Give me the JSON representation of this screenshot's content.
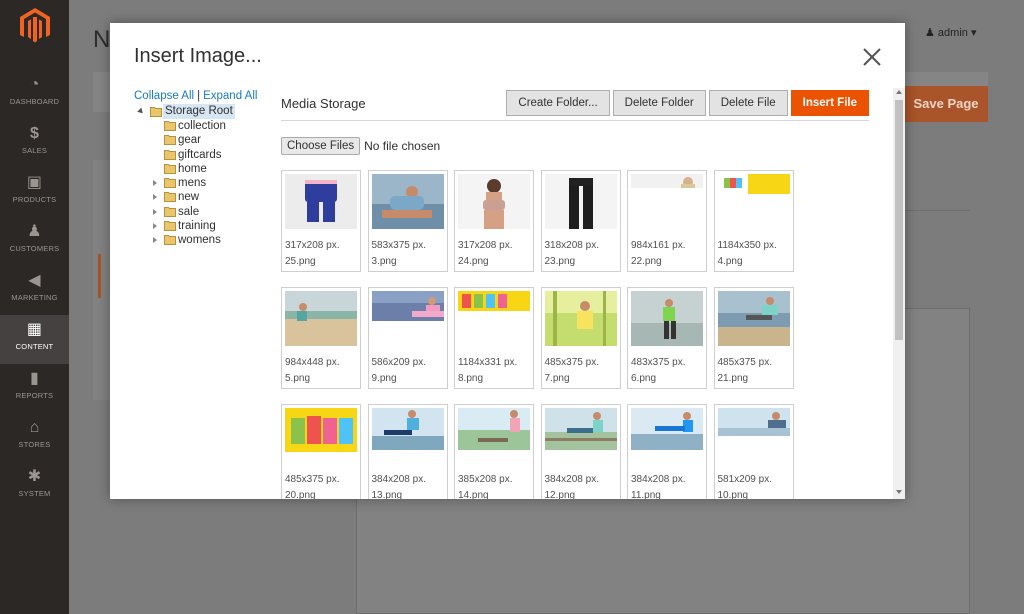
{
  "admin_nav": [
    {
      "label": "DASHBOARD",
      "icon": "dashboard-icon",
      "glyph": "◔"
    },
    {
      "label": "SALES",
      "icon": "dollar-icon",
      "glyph": "$"
    },
    {
      "label": "PRODUCTS",
      "icon": "box-icon",
      "glyph": "▣"
    },
    {
      "label": "CUSTOMERS",
      "icon": "person-icon",
      "glyph": "♟"
    },
    {
      "label": "MARKETING",
      "icon": "megaphone-icon",
      "glyph": "◀"
    },
    {
      "label": "CONTENT",
      "icon": "layout-icon",
      "glyph": "▦"
    },
    {
      "label": "REPORTS",
      "icon": "bar-chart-icon",
      "glyph": "▮"
    },
    {
      "label": "STORES",
      "icon": "store-icon",
      "glyph": "⌂"
    },
    {
      "label": "SYSTEM",
      "icon": "gear-icon",
      "glyph": "✱"
    }
  ],
  "page": {
    "title_partial": "N",
    "user": "admin",
    "save_label": "Save Page"
  },
  "modal": {
    "title": "Insert Image...",
    "collapse_all": "Collapse All",
    "separator": "|",
    "expand_all": "Expand All",
    "tree_root": "Storage Root",
    "folders": [
      "collection",
      "gear",
      "giftcards",
      "home",
      "mens",
      "new",
      "sale",
      "training",
      "womens"
    ],
    "storage_title": "Media Storage",
    "buttons": {
      "create_folder": "Create Folder...",
      "delete_folder": "Delete Folder",
      "delete_file": "Delete File",
      "insert_file": "Insert File"
    },
    "choose_files": "Choose Files",
    "no_file": "No file chosen",
    "files": [
      {
        "dim": "317x208 px.",
        "name": "25.png"
      },
      {
        "dim": "583x375 px.",
        "name": "3.png"
      },
      {
        "dim": "317x208 px.",
        "name": "24.png"
      },
      {
        "dim": "318x208 px.",
        "name": "23.png"
      },
      {
        "dim": "984x161 px.",
        "name": "22.png"
      },
      {
        "dim": "1184x350 px.",
        "name": "4.png"
      },
      {
        "dim": "984x448 px.",
        "name": "5.png"
      },
      {
        "dim": "586x209 px.",
        "name": "9.png"
      },
      {
        "dim": "1184x331 px.",
        "name": "8.png"
      },
      {
        "dim": "485x375 px.",
        "name": "7.png"
      },
      {
        "dim": "483x375 px.",
        "name": "6.png"
      },
      {
        "dim": "485x375 px.",
        "name": "21.png"
      },
      {
        "dim": "485x375 px.",
        "name": "20.png"
      },
      {
        "dim": "384x208 px.",
        "name": "13.png"
      },
      {
        "dim": "385x208 px.",
        "name": "14.png"
      },
      {
        "dim": "384x208 px.",
        "name": "12.png"
      },
      {
        "dim": "384x208 px.",
        "name": "11.png"
      },
      {
        "dim": "581x209 px.",
        "name": "10.png"
      }
    ]
  },
  "colors": {
    "accent": "#eb5202",
    "link": "#1979c3",
    "sidebar": "#2b2826"
  }
}
